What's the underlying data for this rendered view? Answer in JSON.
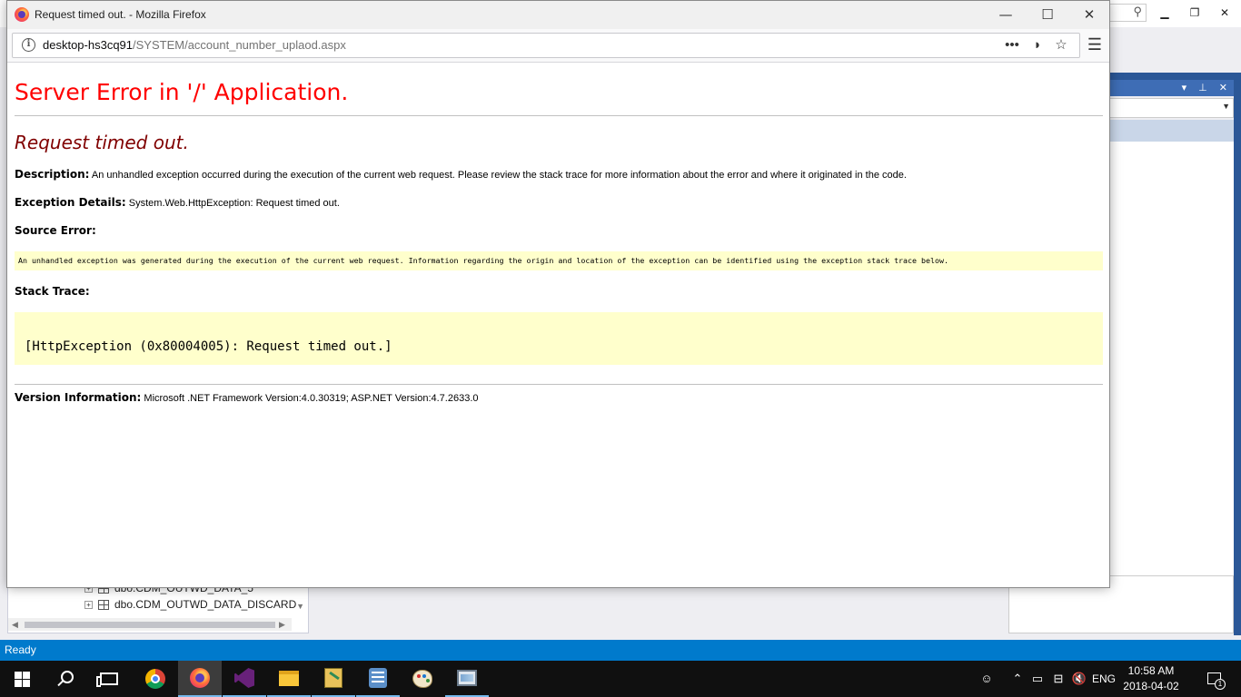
{
  "browser": {
    "window_title": "Request timed out. - Mozilla Firefox",
    "url_host": "desktop-hs3cq91",
    "url_path": "/SYSTEM/account_number_uplaod.aspx"
  },
  "page": {
    "h1": "Server Error in '/' Application.",
    "h2": "Request timed out.",
    "description_label": "Description:",
    "description_text": "An unhandled exception occurred during the execution of the current web request. Please review the stack trace for more information about the error and where it originated in the code.",
    "exception_label": "Exception Details:",
    "exception_text": "System.Web.HttpException: Request timed out.",
    "source_error_label": "Source Error:",
    "source_error_text": "An unhandled exception was generated during the execution of the current web request. Information regarding the origin and location of the exception can be identified using the exception stack trace below.",
    "stack_trace_label": "Stack Trace:",
    "stack_trace_text": "[HttpException (0x80004005): Request timed out.]",
    "version_label": "Version Information:",
    "version_text": "Microsoft .NET Framework Version:4.0.30319; ASP.NET Version:4.7.2633.0"
  },
  "background_app": {
    "tree_items": [
      "dbo.CDM_OUTWD_DATA_5",
      "dbo.CDM_OUTWD_DATA_DISCARD"
    ],
    "status": "Ready"
  },
  "taskbar": {
    "apps": [
      "start",
      "search",
      "task-view",
      "chrome",
      "firefox",
      "visual-studio",
      "file-explorer",
      "tool",
      "sql-server-management",
      "paint",
      "remote-desktop"
    ],
    "language": "ENG",
    "time": "10:58 AM",
    "date": "2018-04-02",
    "notification_count": "1"
  },
  "colors": {
    "error_red": "#ff0000",
    "heading_maroon": "#800000",
    "code_background": "#ffffcc",
    "vs_status_blue": "#007acc"
  }
}
